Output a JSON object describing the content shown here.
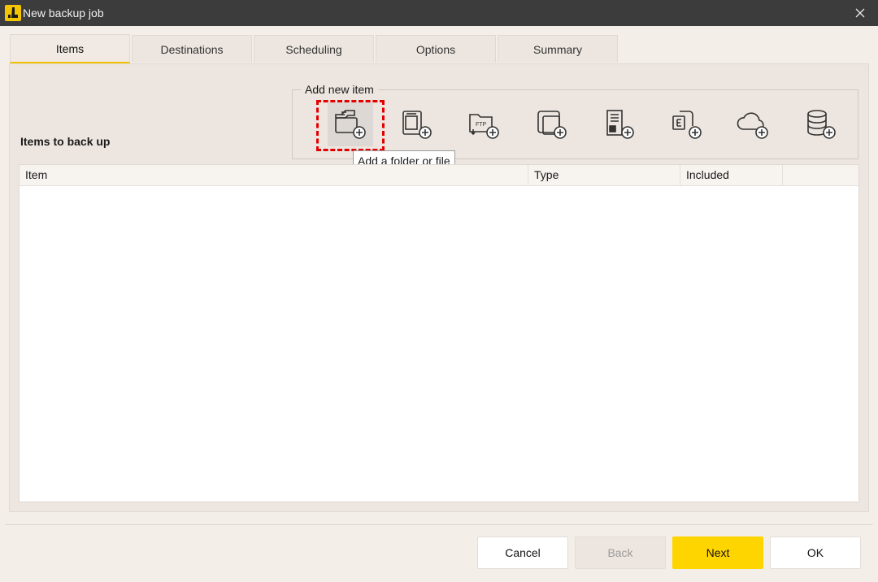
{
  "window": {
    "title": "New backup job",
    "close_icon": "close-icon"
  },
  "tabs": [
    {
      "label": "Items"
    },
    {
      "label": "Destinations"
    },
    {
      "label": "Scheduling"
    },
    {
      "label": "Options"
    },
    {
      "label": "Summary"
    }
  ],
  "items_section": {
    "label": "Items to back up",
    "add_group_label": "Add new item",
    "tooltip": "Add a folder or file",
    "tools": [
      {
        "icon": "folder-file-add-icon"
      },
      {
        "icon": "drive-add-icon"
      },
      {
        "icon": "ftp-folder-add-icon"
      },
      {
        "icon": "copy-window-add-icon"
      },
      {
        "icon": "windows-system-add-icon"
      },
      {
        "icon": "exchange-add-icon"
      },
      {
        "icon": "cloud-add-icon"
      },
      {
        "icon": "database-add-icon"
      }
    ]
  },
  "table": {
    "columns": [
      "Item",
      "Type",
      "Included"
    ],
    "rows": []
  },
  "buttons": {
    "cancel": "Cancel",
    "back": "Back",
    "next": "Next",
    "ok": "OK"
  },
  "colors": {
    "accent": "#ffd500",
    "titlebar": "#3c3c3c",
    "focus": "#e00000"
  }
}
